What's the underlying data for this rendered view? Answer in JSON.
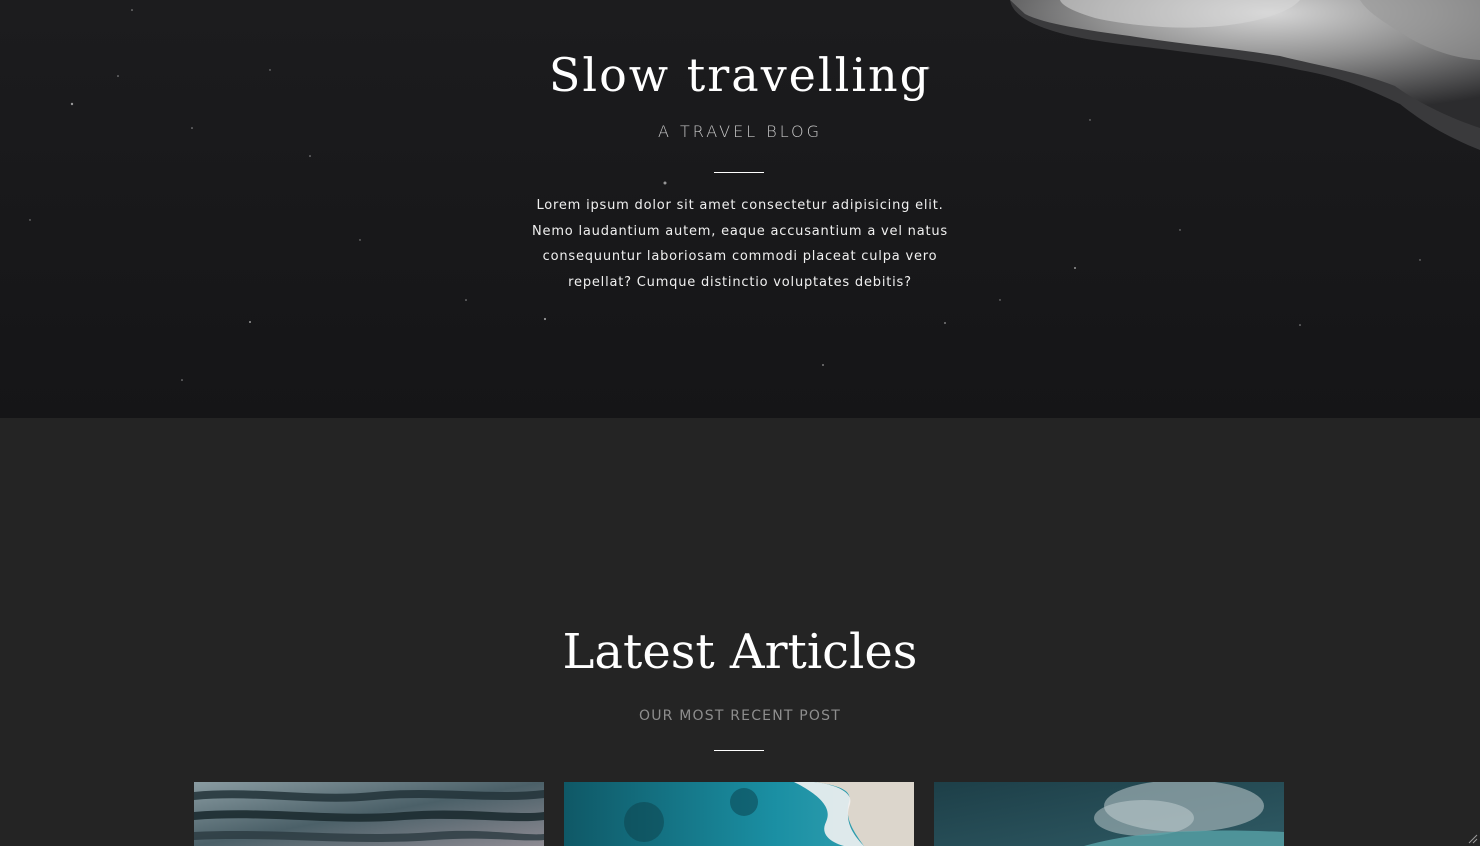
{
  "hero": {
    "title": "Slow travelling",
    "subtitle": "A TRAVEL BLOG",
    "text": "Lorem ipsum dolor sit amet consectetur adipisicing elit. Nemo laudantium autem, eaque accusantium a vel natus consequuntur laboriosam commodi placeat culpa vero repellat? Cumque distinctio voluptates debitis?"
  },
  "articles": {
    "title": "Latest Articles",
    "subtitle": "OUR MOST RECENT POST"
  },
  "colors": {
    "hero_bg": "#18181a",
    "section_bg": "#242424",
    "accent_white": "#ffffff",
    "muted_text": "#8e8e8e"
  }
}
